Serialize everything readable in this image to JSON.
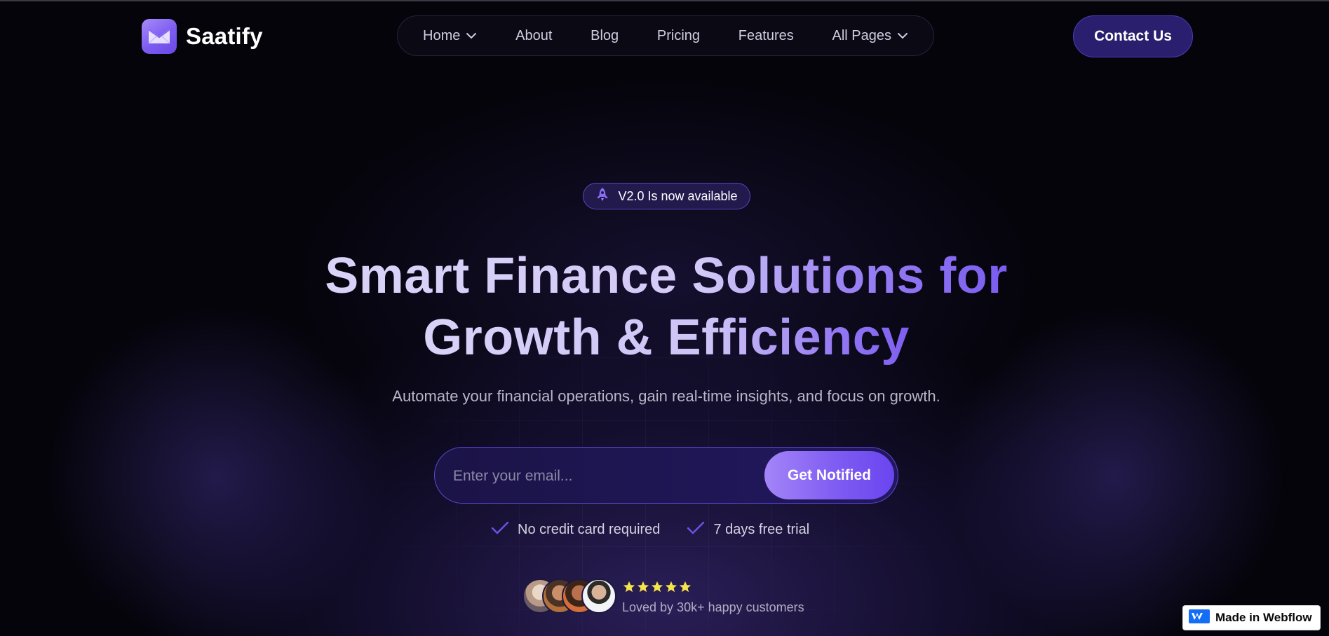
{
  "colors": {
    "background": "#05040b",
    "accent": "#7c5cf0",
    "button_dark": "#2a1f6e",
    "star": "#f5e44a"
  },
  "brand": {
    "name": "Saatify",
    "logo_icon": "envelope-icon"
  },
  "nav": {
    "items": [
      {
        "label": "Home",
        "has_dropdown": true
      },
      {
        "label": "About"
      },
      {
        "label": "Blog"
      },
      {
        "label": "Pricing"
      },
      {
        "label": "Features"
      },
      {
        "label": "All Pages",
        "has_dropdown": true
      }
    ],
    "contact_label": "Contact Us"
  },
  "hero": {
    "badge_icon": "rocket-icon",
    "badge_text": "V2.0 Is now available",
    "title_line1": "Smart Finance Solutions for",
    "title_line2": "Growth & Efficiency",
    "subtitle": "Automate your financial operations, gain real-time insights, and focus on growth."
  },
  "form": {
    "email_placeholder": "Enter your email...",
    "email_value": "",
    "submit_label": "Get Notified"
  },
  "perks": [
    {
      "icon": "check-icon",
      "text": "No credit card required"
    },
    {
      "icon": "check-icon",
      "text": "7 days free trial"
    }
  ],
  "social_proof": {
    "avatar_count": 4,
    "rating_stars": 5,
    "text": "Loved by 30k+ happy customers"
  },
  "webflow_badge": {
    "label": "Made in Webflow",
    "icon": "webflow-logo-icon"
  }
}
